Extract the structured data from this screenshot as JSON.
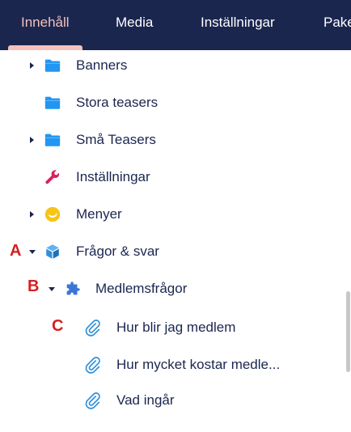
{
  "nav": {
    "tabs": [
      {
        "label": "Innehåll",
        "active": true
      },
      {
        "label": "Media"
      },
      {
        "label": "Inställningar"
      },
      {
        "label": "Paket"
      }
    ]
  },
  "tree": {
    "items": [
      {
        "label": "Banners",
        "icon": "folder-icon",
        "expandable": true
      },
      {
        "label": "Stora teasers",
        "icon": "folder-icon",
        "expandable": false
      },
      {
        "label": "Små Teasers",
        "icon": "folder-icon",
        "expandable": true
      },
      {
        "label": "Inställningar",
        "icon": "wrench-icon",
        "expandable": false
      },
      {
        "label": "Menyer",
        "icon": "menu-circle-icon",
        "expandable": true
      },
      {
        "label": "Frågor & svar",
        "icon": "cube-icon",
        "expandable": true,
        "expanded": true
      },
      {
        "label": "Medlemsfrågor",
        "icon": "puzzle-icon",
        "expandable": true,
        "expanded": true
      },
      {
        "label": "Hur blir jag medlem",
        "icon": "paperclip-icon",
        "expandable": false
      },
      {
        "label": "Hur mycket kostar medle...",
        "icon": "paperclip-icon",
        "expandable": false
      },
      {
        "label": "Vad ingår",
        "icon": "paperclip-icon",
        "expandable": false
      }
    ]
  },
  "annotations": {
    "a": "A",
    "b": "B",
    "c": "C"
  },
  "colors": {
    "topbar": "#1b264f",
    "active_tab": "#f5c1bc",
    "folder": "#2196f3",
    "wrench": "#d9205a",
    "menu_circle": "#f5c518",
    "cube": "#2f8fd9",
    "puzzle": "#3b75d6",
    "paperclip": "#2f8fd9",
    "annotation": "#d42020"
  }
}
